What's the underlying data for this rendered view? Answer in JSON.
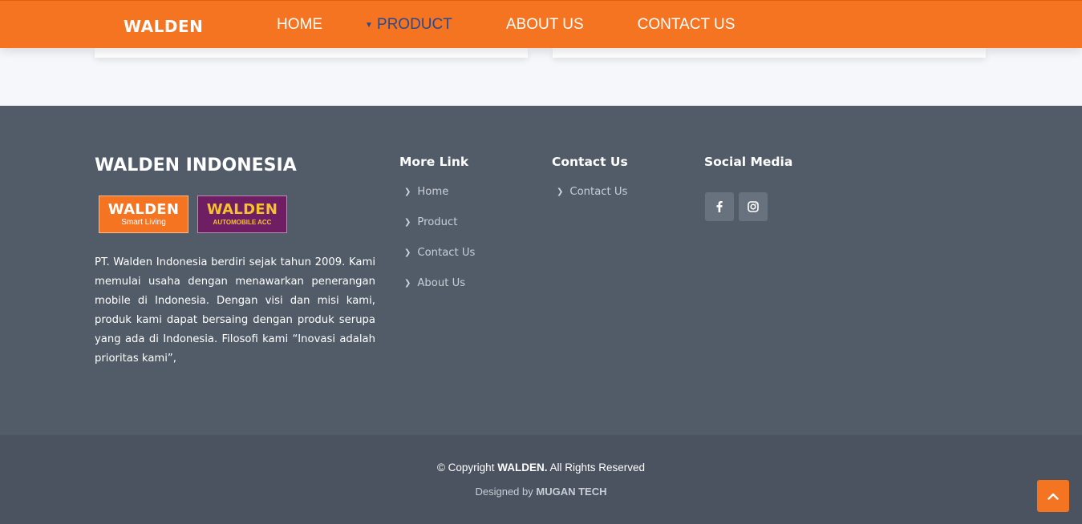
{
  "header": {
    "logo": "WALDEN",
    "nav": [
      {
        "label": "HOME"
      },
      {
        "label": "PRODUCT"
      },
      {
        "label": "ABOUT US"
      },
      {
        "label": "CONTACT US"
      }
    ],
    "active_color": "#2b4a8e",
    "bg_color": "#f47421"
  },
  "footer": {
    "brand_title": "WALDEN INDONESIA",
    "logos": [
      {
        "main": "WALDEN",
        "sub": "Smart Living"
      },
      {
        "main": "WALDEN",
        "sub": "AUTOMOBILE ACC"
      }
    ],
    "about": "PT. Walden Indonesia berdiri sejak tahun 2009. Kami memulai usaha dengan menawarkan penerangan mobile di Indonesia. Dengan visi dan misi kami, produk kami dapat bersaing dengan produk serupa yang ada di Indonesia. Filosofi kami “Inovasi adalah prioritas kami”,",
    "more_link": {
      "title": "More Link",
      "items": [
        "Home",
        "Product",
        "Contact Us",
        "About Us"
      ]
    },
    "contact": {
      "title": "Contact Us",
      "items": [
        "Contact Us"
      ]
    },
    "social": {
      "title": "Social Media",
      "icons": [
        "facebook-icon",
        "instagram-icon"
      ]
    },
    "bg_color": "#525c69"
  },
  "copyright": {
    "prefix": "© Copyright",
    "brand": "WALDEN.",
    "suffix": "All Rights Reserved",
    "designed_prefix": "Designed by",
    "designer": "MUGAN TECH"
  }
}
